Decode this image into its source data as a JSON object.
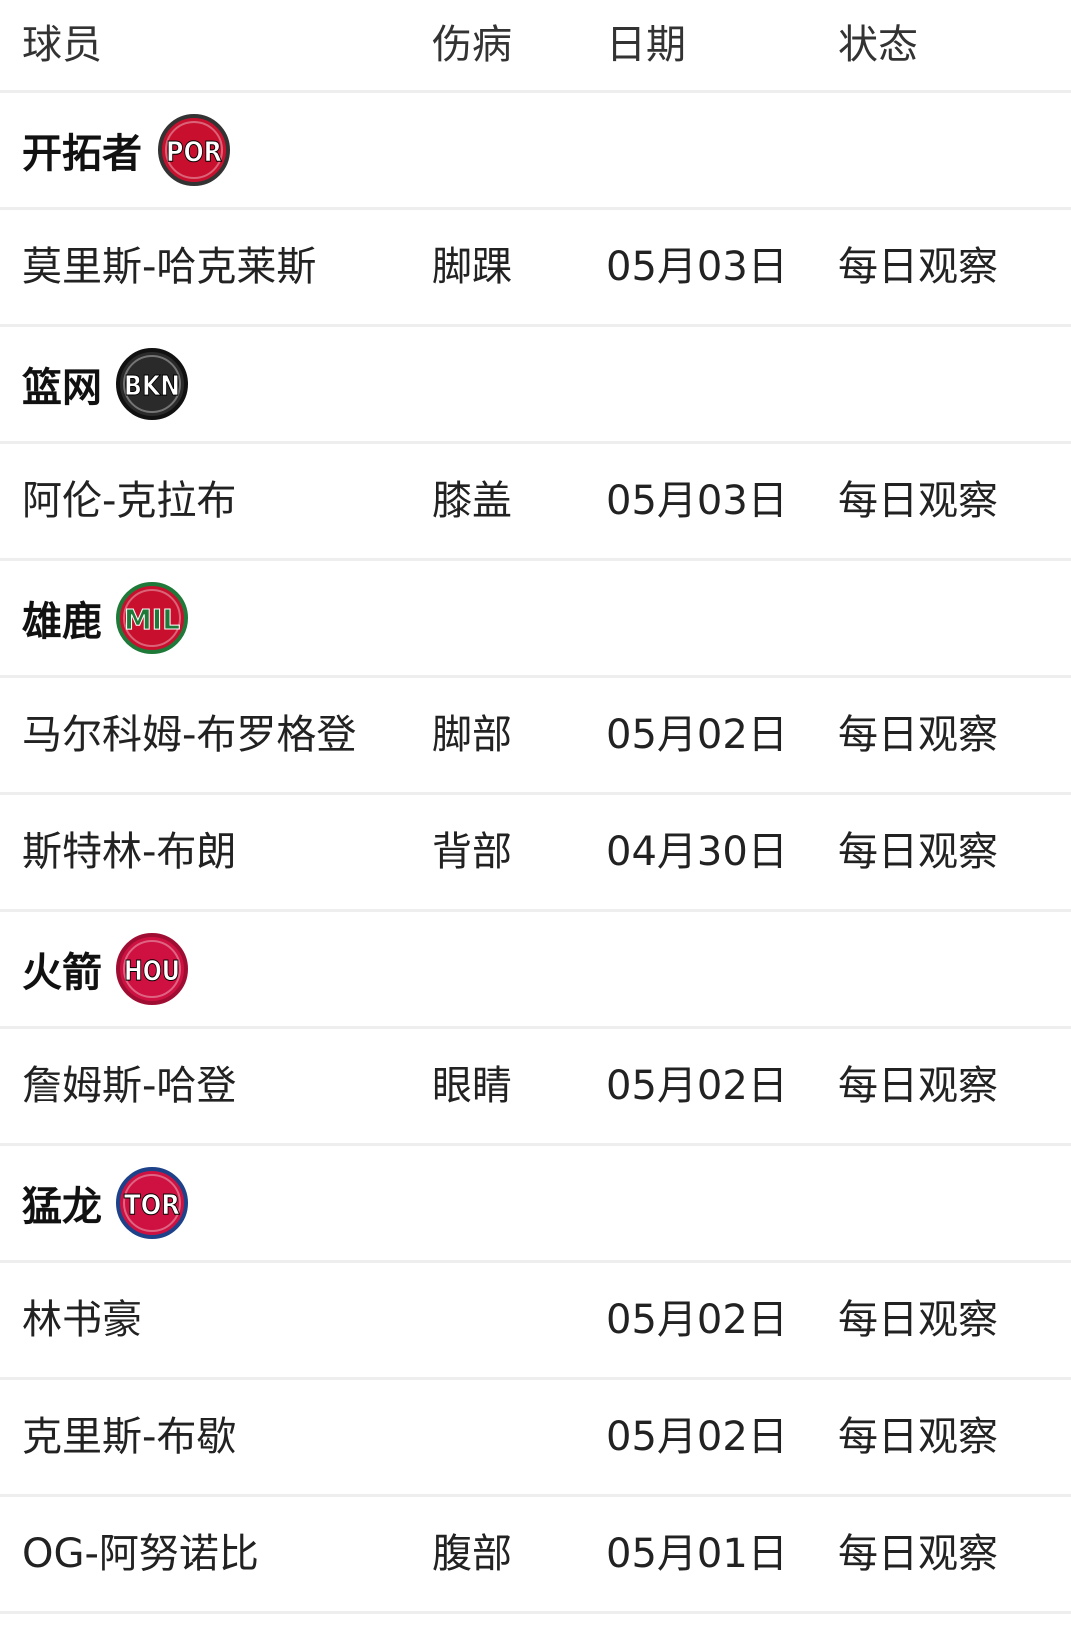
{
  "header": {
    "player": "球员",
    "injury": "伤病",
    "date": "日期",
    "status": "状态"
  },
  "teams": [
    {
      "name": "开拓者",
      "abbr": "POR",
      "colors": {
        "bg": "#c8102e",
        "ring": "#333333",
        "text": "#ffffff"
      },
      "players": [
        {
          "name": "莫里斯-哈克莱斯",
          "injury": "脚踝",
          "date": "05月03日",
          "status": "每日观察"
        }
      ]
    },
    {
      "name": "篮网",
      "abbr": "BKN",
      "colors": {
        "bg": "#2a2a2a",
        "ring": "#111111",
        "text": "#ffffff"
      },
      "players": [
        {
          "name": "阿伦-克拉布",
          "injury": "膝盖",
          "date": "05月03日",
          "status": "每日观察"
        }
      ]
    },
    {
      "name": "雄鹿",
      "abbr": "MIL",
      "colors": {
        "bg": "#c8102e",
        "ring": "#1f7a3a",
        "text": "#1f7a3a"
      },
      "players": [
        {
          "name": "马尔科姆-布罗格登",
          "injury": "脚部",
          "date": "05月02日",
          "status": "每日观察"
        },
        {
          "name": "斯特林-布朗",
          "injury": "背部",
          "date": "04月30日",
          "status": "每日观察"
        }
      ]
    },
    {
      "name": "火箭",
      "abbr": "HOU",
      "colors": {
        "bg": "#ce1141",
        "ring": "#a00d33",
        "text": "#ffffff"
      },
      "players": [
        {
          "name": "詹姆斯-哈登",
          "injury": "眼睛",
          "date": "05月02日",
          "status": "每日观察"
        }
      ]
    },
    {
      "name": "猛龙",
      "abbr": "TOR",
      "colors": {
        "bg": "#ce1141",
        "ring": "#1d428a",
        "text": "#ffffff"
      },
      "players": [
        {
          "name": "林书豪",
          "injury": "",
          "date": "05月02日",
          "status": "每日观察"
        },
        {
          "name": "克里斯-布歇",
          "injury": "",
          "date": "05月02日",
          "status": "每日观察"
        },
        {
          "name": "OG-阿努诺比",
          "injury": "腹部",
          "date": "05月01日",
          "status": "每日观察"
        }
      ]
    }
  ]
}
